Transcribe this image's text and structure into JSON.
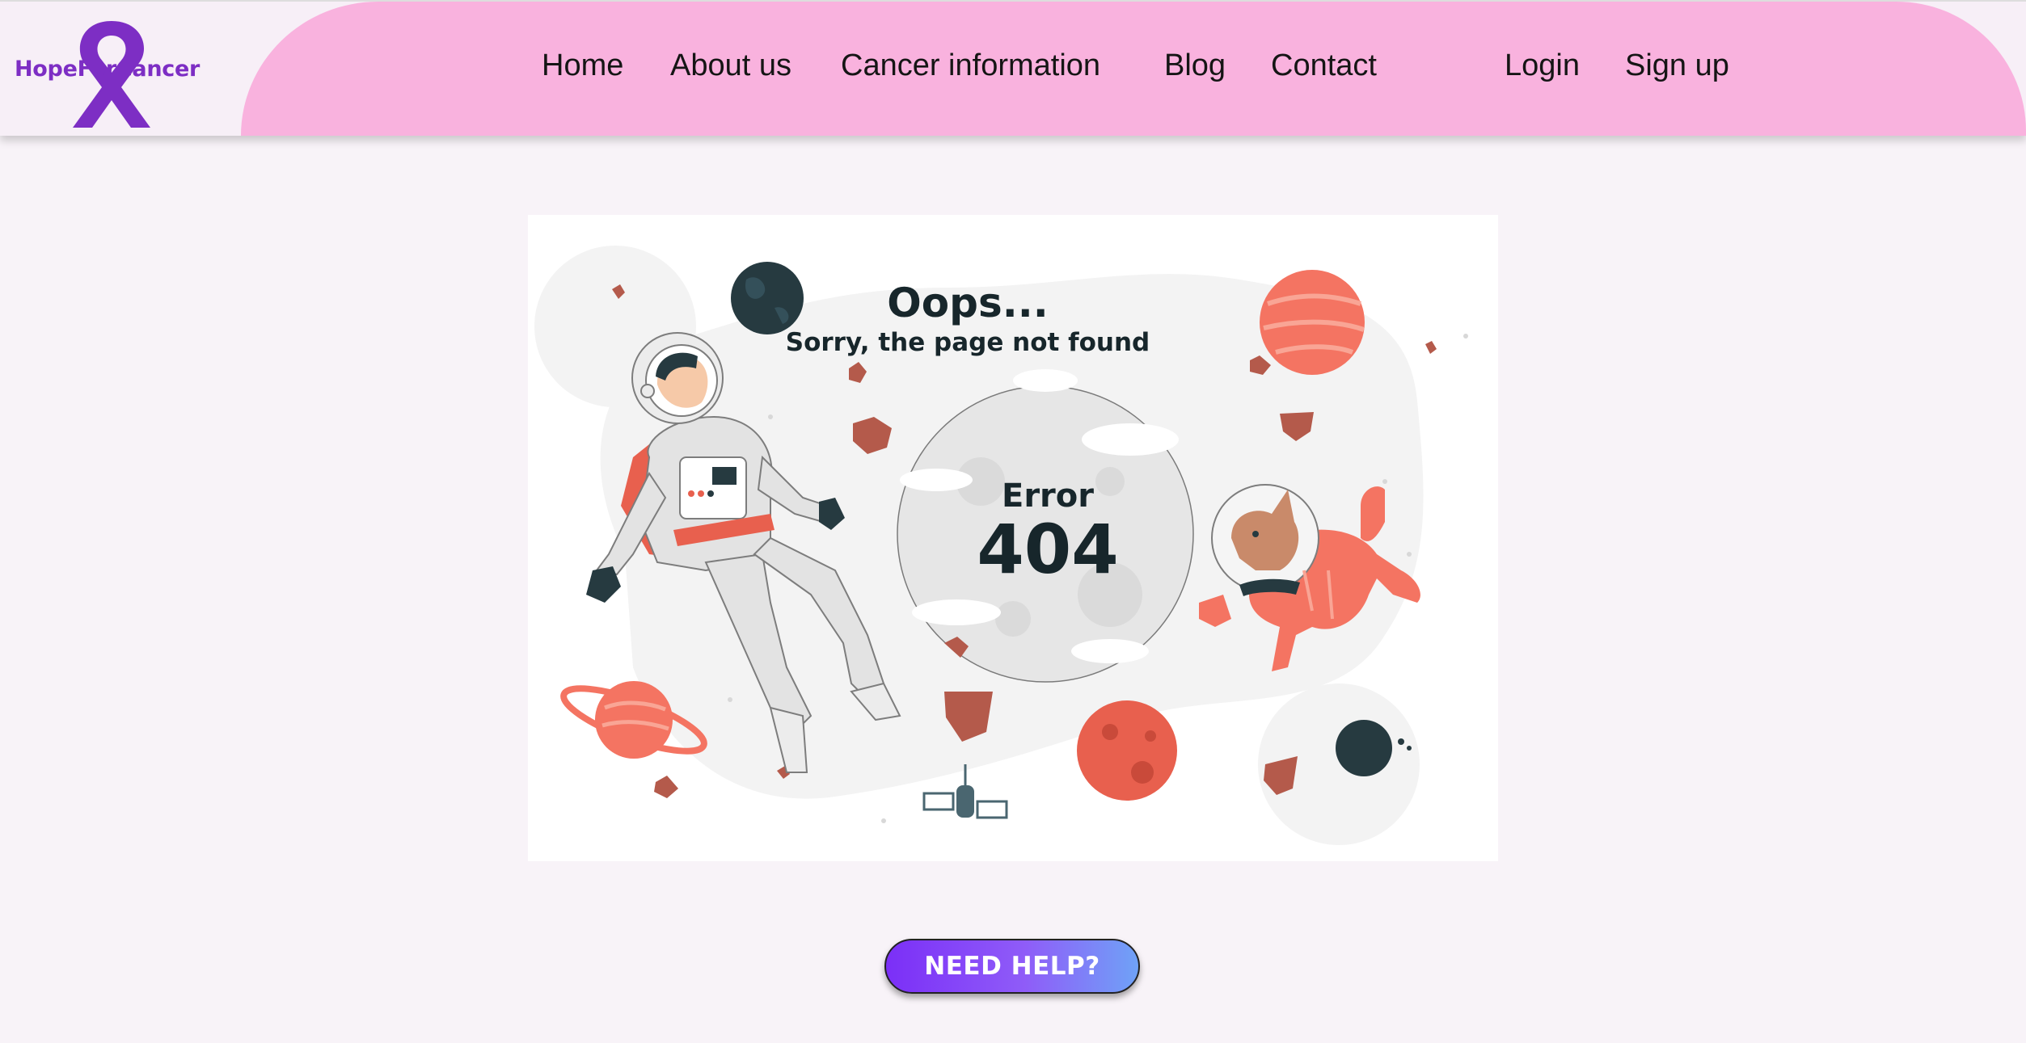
{
  "brand": {
    "name": "HopeForCancer",
    "color": "#7d2ec4"
  },
  "nav": {
    "items": [
      {
        "label": "Home"
      },
      {
        "label": "About us"
      },
      {
        "label": "Cancer information"
      },
      {
        "label": "Blog"
      },
      {
        "label": "Contact"
      },
      {
        "label": "Login"
      },
      {
        "label": "Sign up"
      }
    ]
  },
  "error_illustration": {
    "heading": "Oops...",
    "subheading": "Sorry, the page not found",
    "error_label": "Error",
    "error_code": "404"
  },
  "help_button": {
    "label": "NEED HELP?"
  },
  "colors": {
    "header_pink": "#f9b2de",
    "page_background": "#f8f3f8",
    "button_gradient_start": "#7b2ff7",
    "button_gradient_end": "#6fa2f7"
  }
}
